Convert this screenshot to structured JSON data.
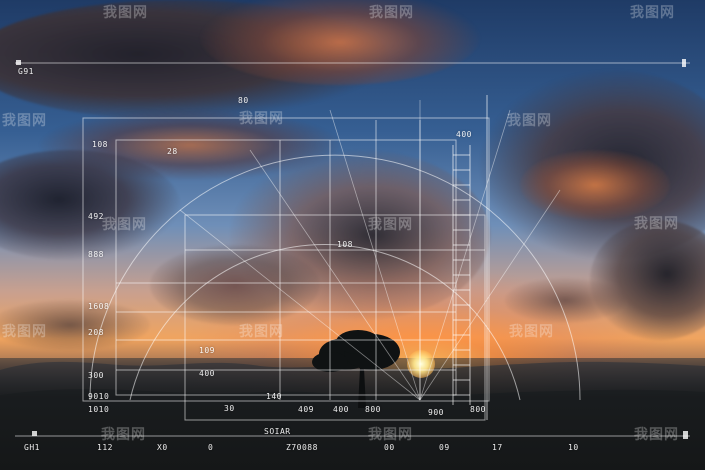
{
  "labels": {
    "top_left": "G91",
    "left_1": "108",
    "left_2": "492",
    "left_3": "888",
    "left_4": "1608",
    "left_5": "208",
    "left_6": "300",
    "left_7": "9010",
    "left_8": "1010",
    "arc_top": "80",
    "arc_left": "28",
    "arc_right": "400",
    "mid_1": "108",
    "mid_2": "109",
    "mid_3": "400",
    "base_1": "30",
    "base_2": "140",
    "base_3": "409",
    "base_4": "400",
    "base_5": "800",
    "base_6": "900",
    "base_7": "800",
    "base_8": "SOIAR",
    "bottom_1": "GH1",
    "bottom_2": "112",
    "bottom_3": "X0",
    "bottom_4": "0",
    "bottom_5": "Z70088",
    "bottom_6": "00",
    "bottom_7": "09",
    "bottom_8": "17",
    "bottom_9": "10"
  },
  "watermark": "我图网"
}
